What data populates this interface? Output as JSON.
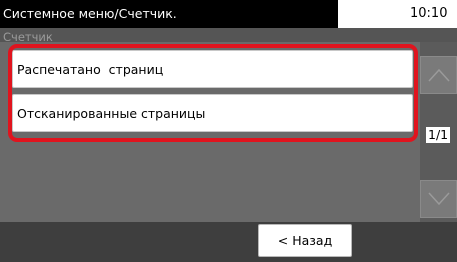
{
  "header": {
    "title": "Системное меню/Счетчик.",
    "time": "10:10",
    "subtitle": "Счетчик"
  },
  "list": {
    "items": [
      {
        "label": "Распечатано  страниц"
      },
      {
        "label": "Отсканированные страницы"
      }
    ],
    "page_indicator": "1/1"
  },
  "footer": {
    "back_label": "< Назад"
  },
  "icons": {
    "scroll_up": "chevron-up-icon",
    "scroll_down": "chevron-down-icon"
  },
  "colors": {
    "highlight": "#e0141e",
    "title_bar": "#000000",
    "panel": "#555555"
  }
}
